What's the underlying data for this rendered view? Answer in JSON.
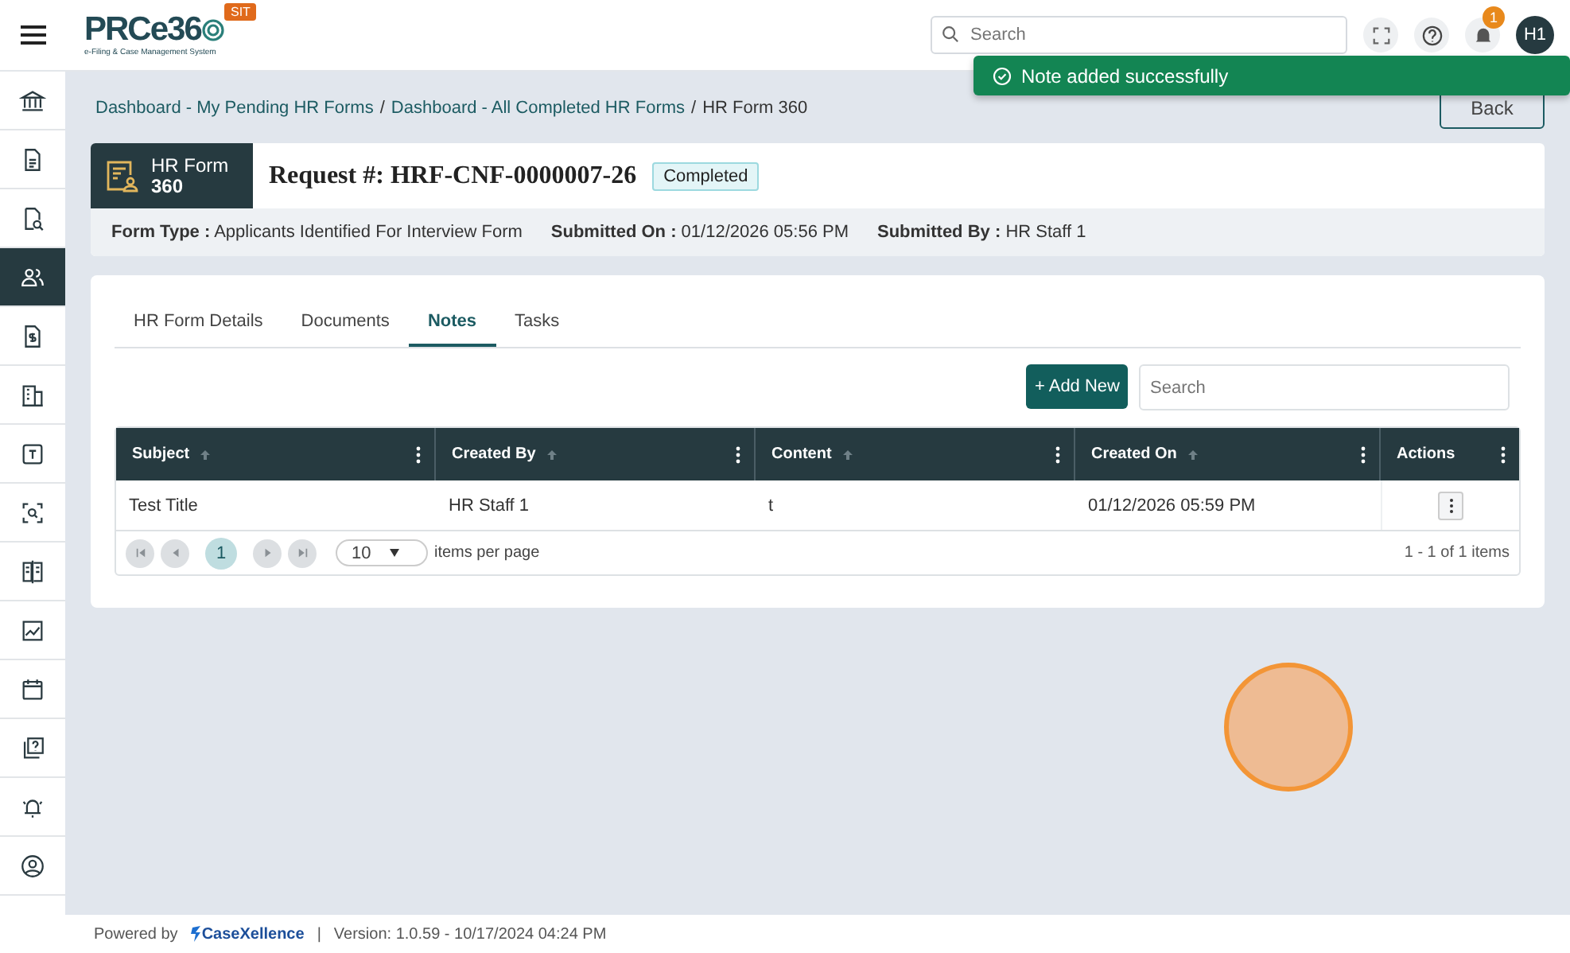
{
  "header": {
    "logo": {
      "text": "PRCe36",
      "subtitle": "e-Filing & Case Management System",
      "env_badge": "SIT"
    },
    "search": {
      "placeholder": "Search"
    },
    "notification_count": "1",
    "avatar": "H1"
  },
  "toast": {
    "message": "Note added successfully"
  },
  "sidebar": {
    "items": [
      {
        "selected": false
      },
      {
        "selected": false
      },
      {
        "selected": false
      },
      {
        "selected": true
      },
      {
        "selected": false
      },
      {
        "selected": false
      },
      {
        "selected": false
      },
      {
        "selected": false
      },
      {
        "selected": false
      },
      {
        "selected": false
      },
      {
        "selected": false
      },
      {
        "selected": false
      },
      {
        "selected": false
      },
      {
        "selected": false
      }
    ]
  },
  "breadcrumb": {
    "separator": "/",
    "items": [
      {
        "label": "Dashboard - My Pending HR Forms",
        "link": true
      },
      {
        "label": "Dashboard - All Completed HR Forms",
        "link": true
      },
      {
        "label": "HR Form 360",
        "link": false
      }
    ]
  },
  "back_button": "Back",
  "request": {
    "badge": {
      "line1": "HR Form",
      "line2": "360"
    },
    "title": "Request #: HRF-CNF-0000007-26",
    "status": "Completed",
    "fields": [
      {
        "label": "Form Type :",
        "value": "Applicants Identified For Interview Form"
      },
      {
        "label": "Submitted On :",
        "value": "01/12/2026 05:56 PM"
      },
      {
        "label": "Submitted By :",
        "value": "HR Staff 1"
      }
    ]
  },
  "tabs": [
    {
      "label": "HR Form Details",
      "selected": false
    },
    {
      "label": "Documents",
      "selected": false
    },
    {
      "label": "Notes",
      "selected": true
    },
    {
      "label": "Tasks",
      "selected": false
    }
  ],
  "notes": {
    "add_button": "+ Add New",
    "search": {
      "placeholder": "Search"
    },
    "table": {
      "columns": [
        {
          "label": "Subject",
          "sortable": true
        },
        {
          "label": "Created By",
          "sortable": true
        },
        {
          "label": "Content",
          "sortable": true
        },
        {
          "label": "Created On",
          "sortable": true
        },
        {
          "label": "Actions",
          "sortable": false
        }
      ],
      "rows": [
        [
          "Test Title",
          "HR Staff 1",
          "t",
          "01/12/2026 05:59 PM"
        ]
      ]
    },
    "pager": {
      "current_page": "1",
      "page_size": "10",
      "page_size_label": "items per page",
      "summary": "1 - 1 of 1 items"
    }
  },
  "footer": {
    "powered_by": "Powered by",
    "brand": "CaseXellence",
    "separator": "|",
    "version": "Version: 1.0.59 - 10/17/2024 04:24 PM"
  }
}
